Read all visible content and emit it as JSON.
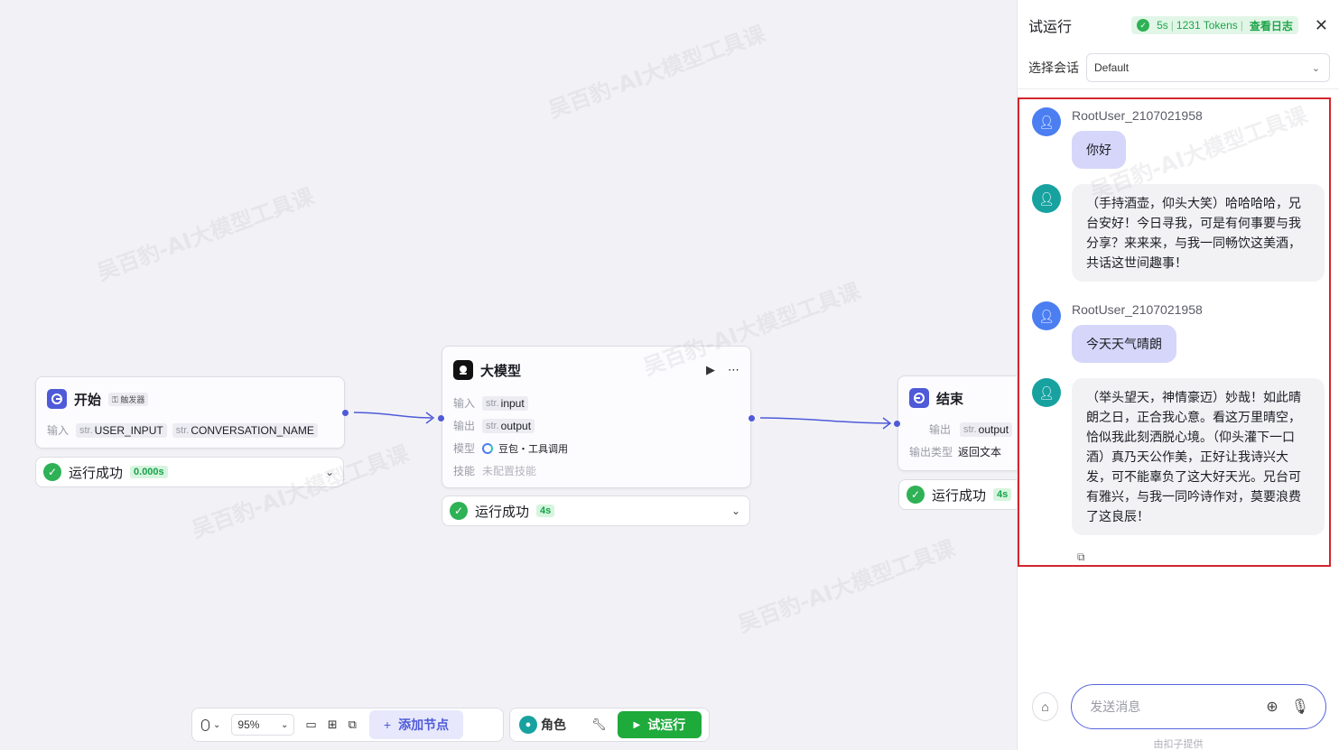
{
  "nodes": {
    "start": {
      "title": "开始",
      "badge": "触发器",
      "input_label": "输入",
      "inputs": [
        {
          "type": "str.",
          "name": "USER_INPUT"
        },
        {
          "type": "str.",
          "name": "CONVERSATION_NAME"
        }
      ],
      "status": "运行成功",
      "time": "0.000s"
    },
    "llm": {
      "title": "大模型",
      "input_label": "输入",
      "input": {
        "type": "str.",
        "name": "input"
      },
      "output_label": "输出",
      "output": {
        "type": "str.",
        "name": "output"
      },
      "model_label": "模型",
      "model": "豆包・工具调用",
      "skill_label": "技能",
      "skill": "未配置技能",
      "status": "运行成功",
      "time": "4s"
    },
    "end": {
      "title": "结束",
      "output_label": "输出",
      "output": {
        "type": "str.",
        "name": "output"
      },
      "output_type_label": "输出类型",
      "output_type": "返回文本",
      "status": "运行成功",
      "time": "4s"
    }
  },
  "toolbar": {
    "zoom": "95%",
    "add_node": "添加节点",
    "role": "角色",
    "run": "试运行"
  },
  "panel": {
    "title": "试运行",
    "duration": "5s",
    "tokens": "1231 Tokens",
    "view_log": "查看日志",
    "conversation_label": "选择会话",
    "conversation_value": "Default",
    "messages": [
      {
        "role": "user",
        "name": "RootUser_2107021958",
        "text": "你好"
      },
      {
        "role": "bot",
        "text": "（手持酒壶，仰头大笑）哈哈哈哈，兄台安好！今日寻我，可是有何事要与我分享？来来来，与我一同畅饮这美酒，共话这世间趣事！"
      },
      {
        "role": "user",
        "name": "RootUser_2107021958",
        "text": "今天天气晴朗"
      },
      {
        "role": "bot",
        "text": "（举头望天，神情豪迈）妙哉！如此晴朗之日，正合我心意。看这万里晴空，恰似我此刻洒脱心境。（仰头灌下一口酒）真乃天公作美，正好让我诗兴大发，可不能辜负了这大好天光。兄台可有雅兴，与我一同吟诗作对，莫要浪费了这良辰！"
      }
    ],
    "input_placeholder": "发送消息",
    "powered_by": "由扣子提供"
  },
  "watermark": "吴百豹-AI大模型工具课",
  "colors": {
    "accent": "#4e5ad8",
    "success": "#2fb155",
    "run_button": "#1faa3c",
    "user_bubble": "#d5d6fa",
    "highlight_border": "#d3262e"
  }
}
